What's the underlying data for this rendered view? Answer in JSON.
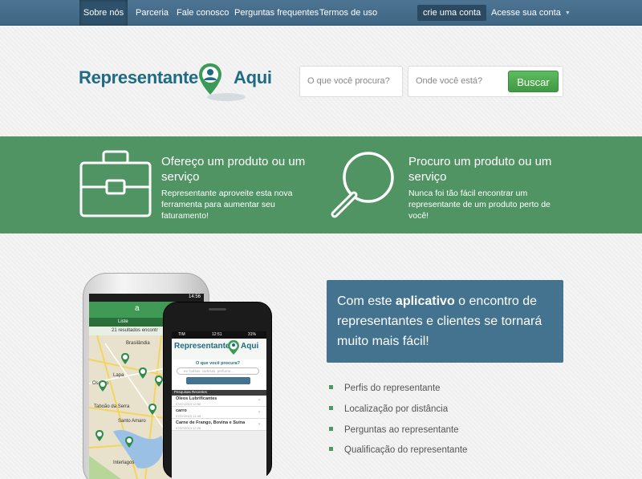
{
  "nav": {
    "items": [
      "Sobre nós",
      "Parceria",
      "Fale conosco",
      "Perguntas frequentes",
      "Termos de uso"
    ],
    "signup": "crie uma conta",
    "login": "Acesse sua conta"
  },
  "brand": {
    "part1": "Representante",
    "part2": "Aqui"
  },
  "search": {
    "what_placeholder": "O que você procura?",
    "where_placeholder": "Onde você está?",
    "button": "Buscar"
  },
  "band": {
    "offer_title": "Ofereço um produto ou um serviço",
    "offer_text": "Representante aproveite esta nova ferramenta para aumentar seu faturamento!",
    "seek_title": "Procuro um produto ou um serviço",
    "seek_text": "Nunca foi tão fácil encontrar um representante de um produto perto de você!"
  },
  "promo": {
    "before": "Com este ",
    "bold": "aplicativo",
    "after": " o encontro de representantes e clientes se tornará muito mais fácil!"
  },
  "features": [
    "Perfis do representante",
    "Localização por distância",
    "Perguntas ao representante",
    "Qualificação do representante"
  ],
  "android": {
    "time": "14:56",
    "tab_list": "Liste",
    "results": "21 resultados encontr",
    "places": [
      "Brasilândia",
      "Lapa",
      "Osasco",
      "Taboão da Serra",
      "Santo Amaro",
      "Interlagos"
    ]
  },
  "iphone": {
    "carrier": "TIM",
    "time": "12:51",
    "battery": "31%",
    "question": "O que você procura?",
    "input_placeholder": "ex: bolsas, camisas, perfume...",
    "button": "Buscar Representante",
    "recent_header": "Pesquisas Recentes",
    "recent": [
      {
        "title": "Oleos Lubrificantes",
        "date": "07/07/2013 12:50"
      },
      {
        "title": "carro",
        "date": "07/07/2013 12:49"
      },
      {
        "title": "Carne de Frango, Bovina e Suína",
        "date": "07/07/2013 12:28"
      }
    ]
  },
  "colors": {
    "nav": "#44708f",
    "green": "#519464",
    "promo": "#44738f",
    "button": "#4aa84e"
  }
}
